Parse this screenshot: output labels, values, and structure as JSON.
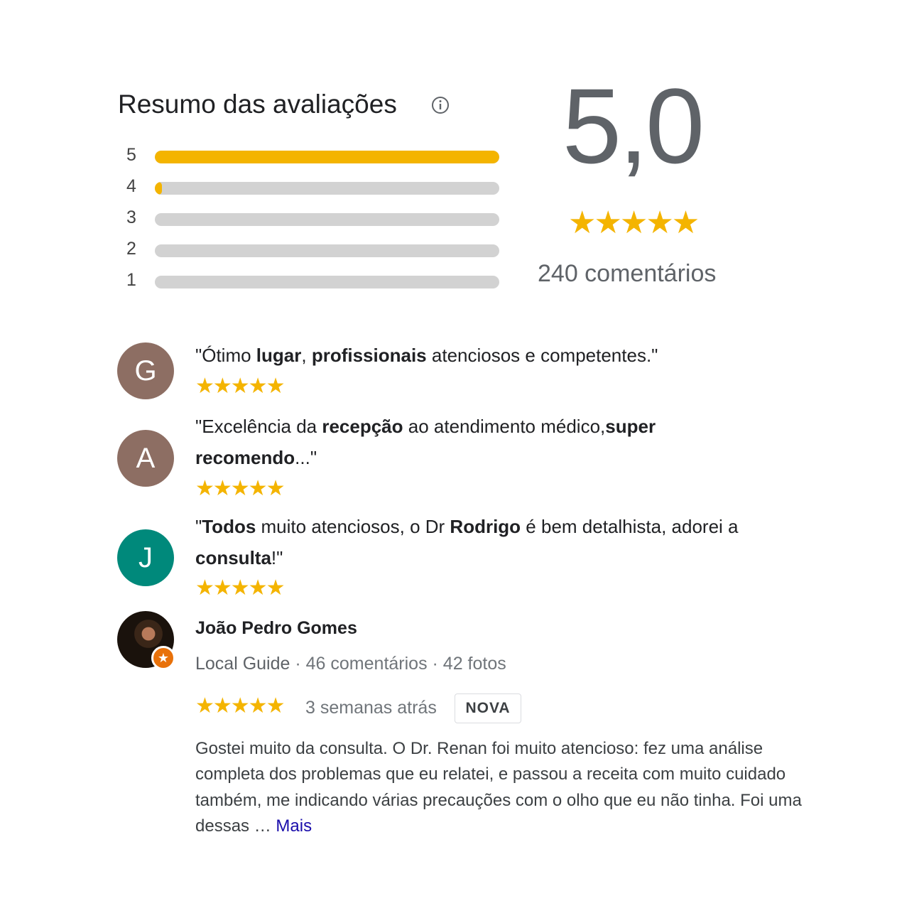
{
  "summary": {
    "title": "Resumo das avaliações",
    "info_icon": "info-icon",
    "score": "5,0",
    "stars": "★★★★★",
    "count_label": "240 comentários",
    "distribution": [
      {
        "stars": "5",
        "fraction": 1.0
      },
      {
        "stars": "4",
        "fraction": 0.02
      },
      {
        "stars": "3",
        "fraction": 0.0
      },
      {
        "stars": "2",
        "fraction": 0.0
      },
      {
        "stars": "1",
        "fraction": 0.0
      }
    ]
  },
  "colors": {
    "star": "#f4b400",
    "bar_track": "#d2d2d2",
    "avatar_g": "#8d6e63",
    "avatar_a": "#8d6e63",
    "avatar_j": "#00897b",
    "link": "#1a0dab"
  },
  "reviews": [
    {
      "initial": "G",
      "quote_parts": [
        "\"Ótimo ",
        "lugar",
        ", ",
        "profissionais",
        " atenciosos e competentes.\""
      ],
      "stars": "★★★★★"
    },
    {
      "initial": "A",
      "quote_parts": [
        "\"Excelência da ",
        "recepção",
        " ao atendimento médico,",
        "super recomendo",
        "...\""
      ],
      "stars": "★★★★★"
    },
    {
      "initial": "J",
      "quote_parts": [
        "\"",
        "Todos",
        " muito atenciosos, o Dr ",
        "Rodrigo",
        " é bem detalhista, adorei a ",
        "consulta",
        "!\""
      ],
      "stars": "★★★★★"
    }
  ],
  "full_review": {
    "name": "João Pedro Gomes",
    "guide": "Local Guide",
    "meta": " · 46 comentários · 42 fotos",
    "stars": "★★★★★",
    "time": "3 semanas atrás",
    "badge": "NOVA",
    "body": "Gostei muito da consulta. O Dr. Renan foi muito atencioso: fez uma análise completa dos problemas que eu relatei, e passou a receita com muito cuidado também, me indicando várias precauções com o olho que eu não tinha. Foi uma dessas … ",
    "more": "Mais",
    "badge_icon": "local-guide-star-icon"
  }
}
